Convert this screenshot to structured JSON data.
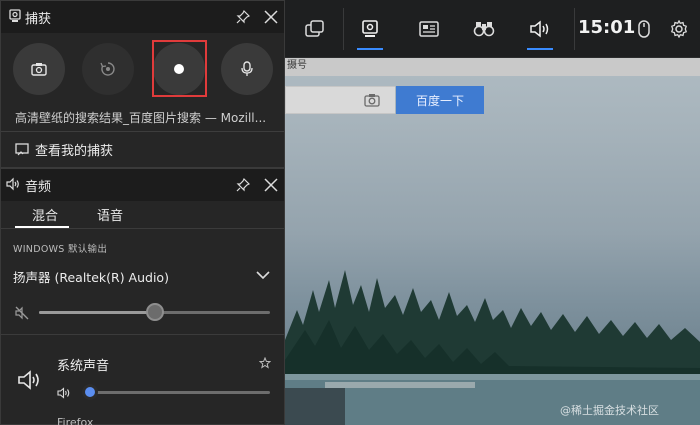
{
  "capture_panel": {
    "title": "捕获",
    "source_title": "高清壁纸的搜索结果_百度图片搜索 — Mozill...",
    "view_captures": "查看我的捕获"
  },
  "audio_panel": {
    "title": "音频",
    "tabs": [
      {
        "label": "混合"
      },
      {
        "label": "语音"
      }
    ],
    "section_label": "WINDOWS 默认输出",
    "device_name": "扬声器 (Realtek(R) Audio)",
    "master_volume_fraction": 0.5,
    "app": {
      "name": "系统声音",
      "volume_fraction": 0.0
    },
    "next_app_partial": "Firefox"
  },
  "top_bar": {
    "clock": "15:01"
  },
  "browser": {
    "search_button": "百度一下",
    "strip_text": "摄号"
  },
  "watermark": "@稀土掘金技术社区",
  "colors": {
    "accent_blue": "#3a8cff",
    "record_outline": "#e03b3b",
    "search_blue": "#3f7bd1"
  }
}
